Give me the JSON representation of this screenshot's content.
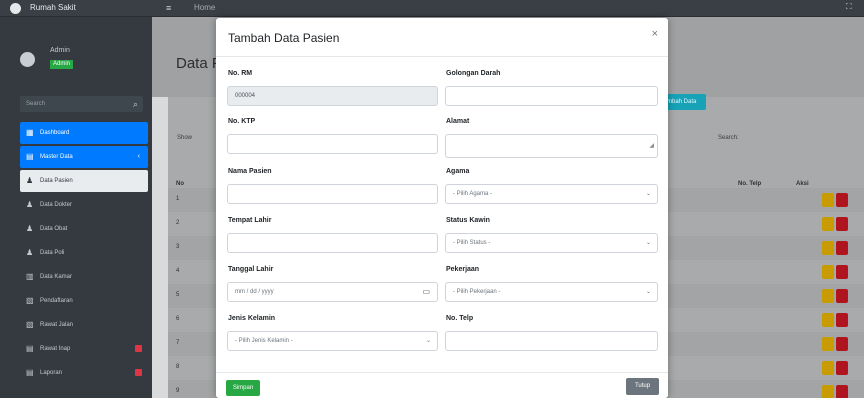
{
  "app": {
    "title": "Rumah Sakit",
    "nav_text": "Home"
  },
  "sidebar": {
    "user_name": "Admin",
    "user_role": "Admin",
    "search_placeholder": "Search",
    "items": [
      {
        "label": "Dashboard",
        "icon": "dashboard-icon",
        "state": "active"
      },
      {
        "label": "Master Data",
        "icon": "database-icon",
        "state": "active-parent"
      },
      {
        "label": "Data Pasien",
        "icon": "user-icon",
        "state": "sub"
      },
      {
        "label": "Data Dokter",
        "icon": "user-icon",
        "state": ""
      },
      {
        "label": "Data Obat",
        "icon": "user-icon",
        "state": ""
      },
      {
        "label": "Data Poli",
        "icon": "user-icon",
        "state": ""
      },
      {
        "label": "Data Kamar",
        "icon": "building-icon",
        "state": ""
      },
      {
        "label": "Pendaftaran",
        "icon": "clipboard-icon",
        "state": ""
      },
      {
        "label": "Rawat Jalan",
        "icon": "clipboard-icon",
        "state": ""
      },
      {
        "label": "Rawat Inap",
        "icon": "table-icon",
        "state": "badge"
      },
      {
        "label": "Laporan",
        "icon": "table-icon",
        "state": "badge"
      }
    ]
  },
  "content": {
    "page_title": "Data Pasien",
    "add_button": "Tambah Data",
    "show_label": "Show",
    "search_label": "Search:",
    "columns": [
      "No",
      "No. Telp",
      "Aksi"
    ],
    "rows": [
      "1",
      "2",
      "3",
      "4",
      "5",
      "6",
      "7",
      "8",
      "9"
    ]
  },
  "modal": {
    "title": "Tambah Data Pasien",
    "close_icon": "×",
    "fields": {
      "no_rm": {
        "label": "No. RM",
        "value": "000004"
      },
      "no_ktp": {
        "label": "No. KTP",
        "placeholder": ""
      },
      "nama": {
        "label": "Nama Pasien",
        "placeholder": ""
      },
      "tempat_lahir": {
        "label": "Tempat Lahir",
        "placeholder": ""
      },
      "tanggal_lahir": {
        "label": "Tanggal Lahir",
        "placeholder": "mm / dd / yyyy"
      },
      "jenis_kelamin": {
        "label": "Jenis Kelamin",
        "selected": "- Pilih Jenis Kelamin -"
      },
      "golongan_darah": {
        "label": "Golongan Darah",
        "placeholder": ""
      },
      "alamat": {
        "label": "Alamat",
        "placeholder": ""
      },
      "agama": {
        "label": "Agama",
        "selected": "- Pilih Agama -"
      },
      "status_kawin": {
        "label": "Status Kawin",
        "selected": "- Pilih Status -"
      },
      "pekerjaan": {
        "label": "Pekerjaan",
        "selected": "- Pilih Pekerjaan -"
      },
      "no_telp": {
        "label": "No. Telp",
        "placeholder": ""
      }
    },
    "save_button": "Simpan",
    "close_button": "Tutup"
  },
  "colors": {
    "primary": "#007bff",
    "success": "#28a745",
    "info": "#17a2b8",
    "warning": "#c89b00",
    "danger": "#b0141f",
    "secondary": "#6c757d"
  }
}
